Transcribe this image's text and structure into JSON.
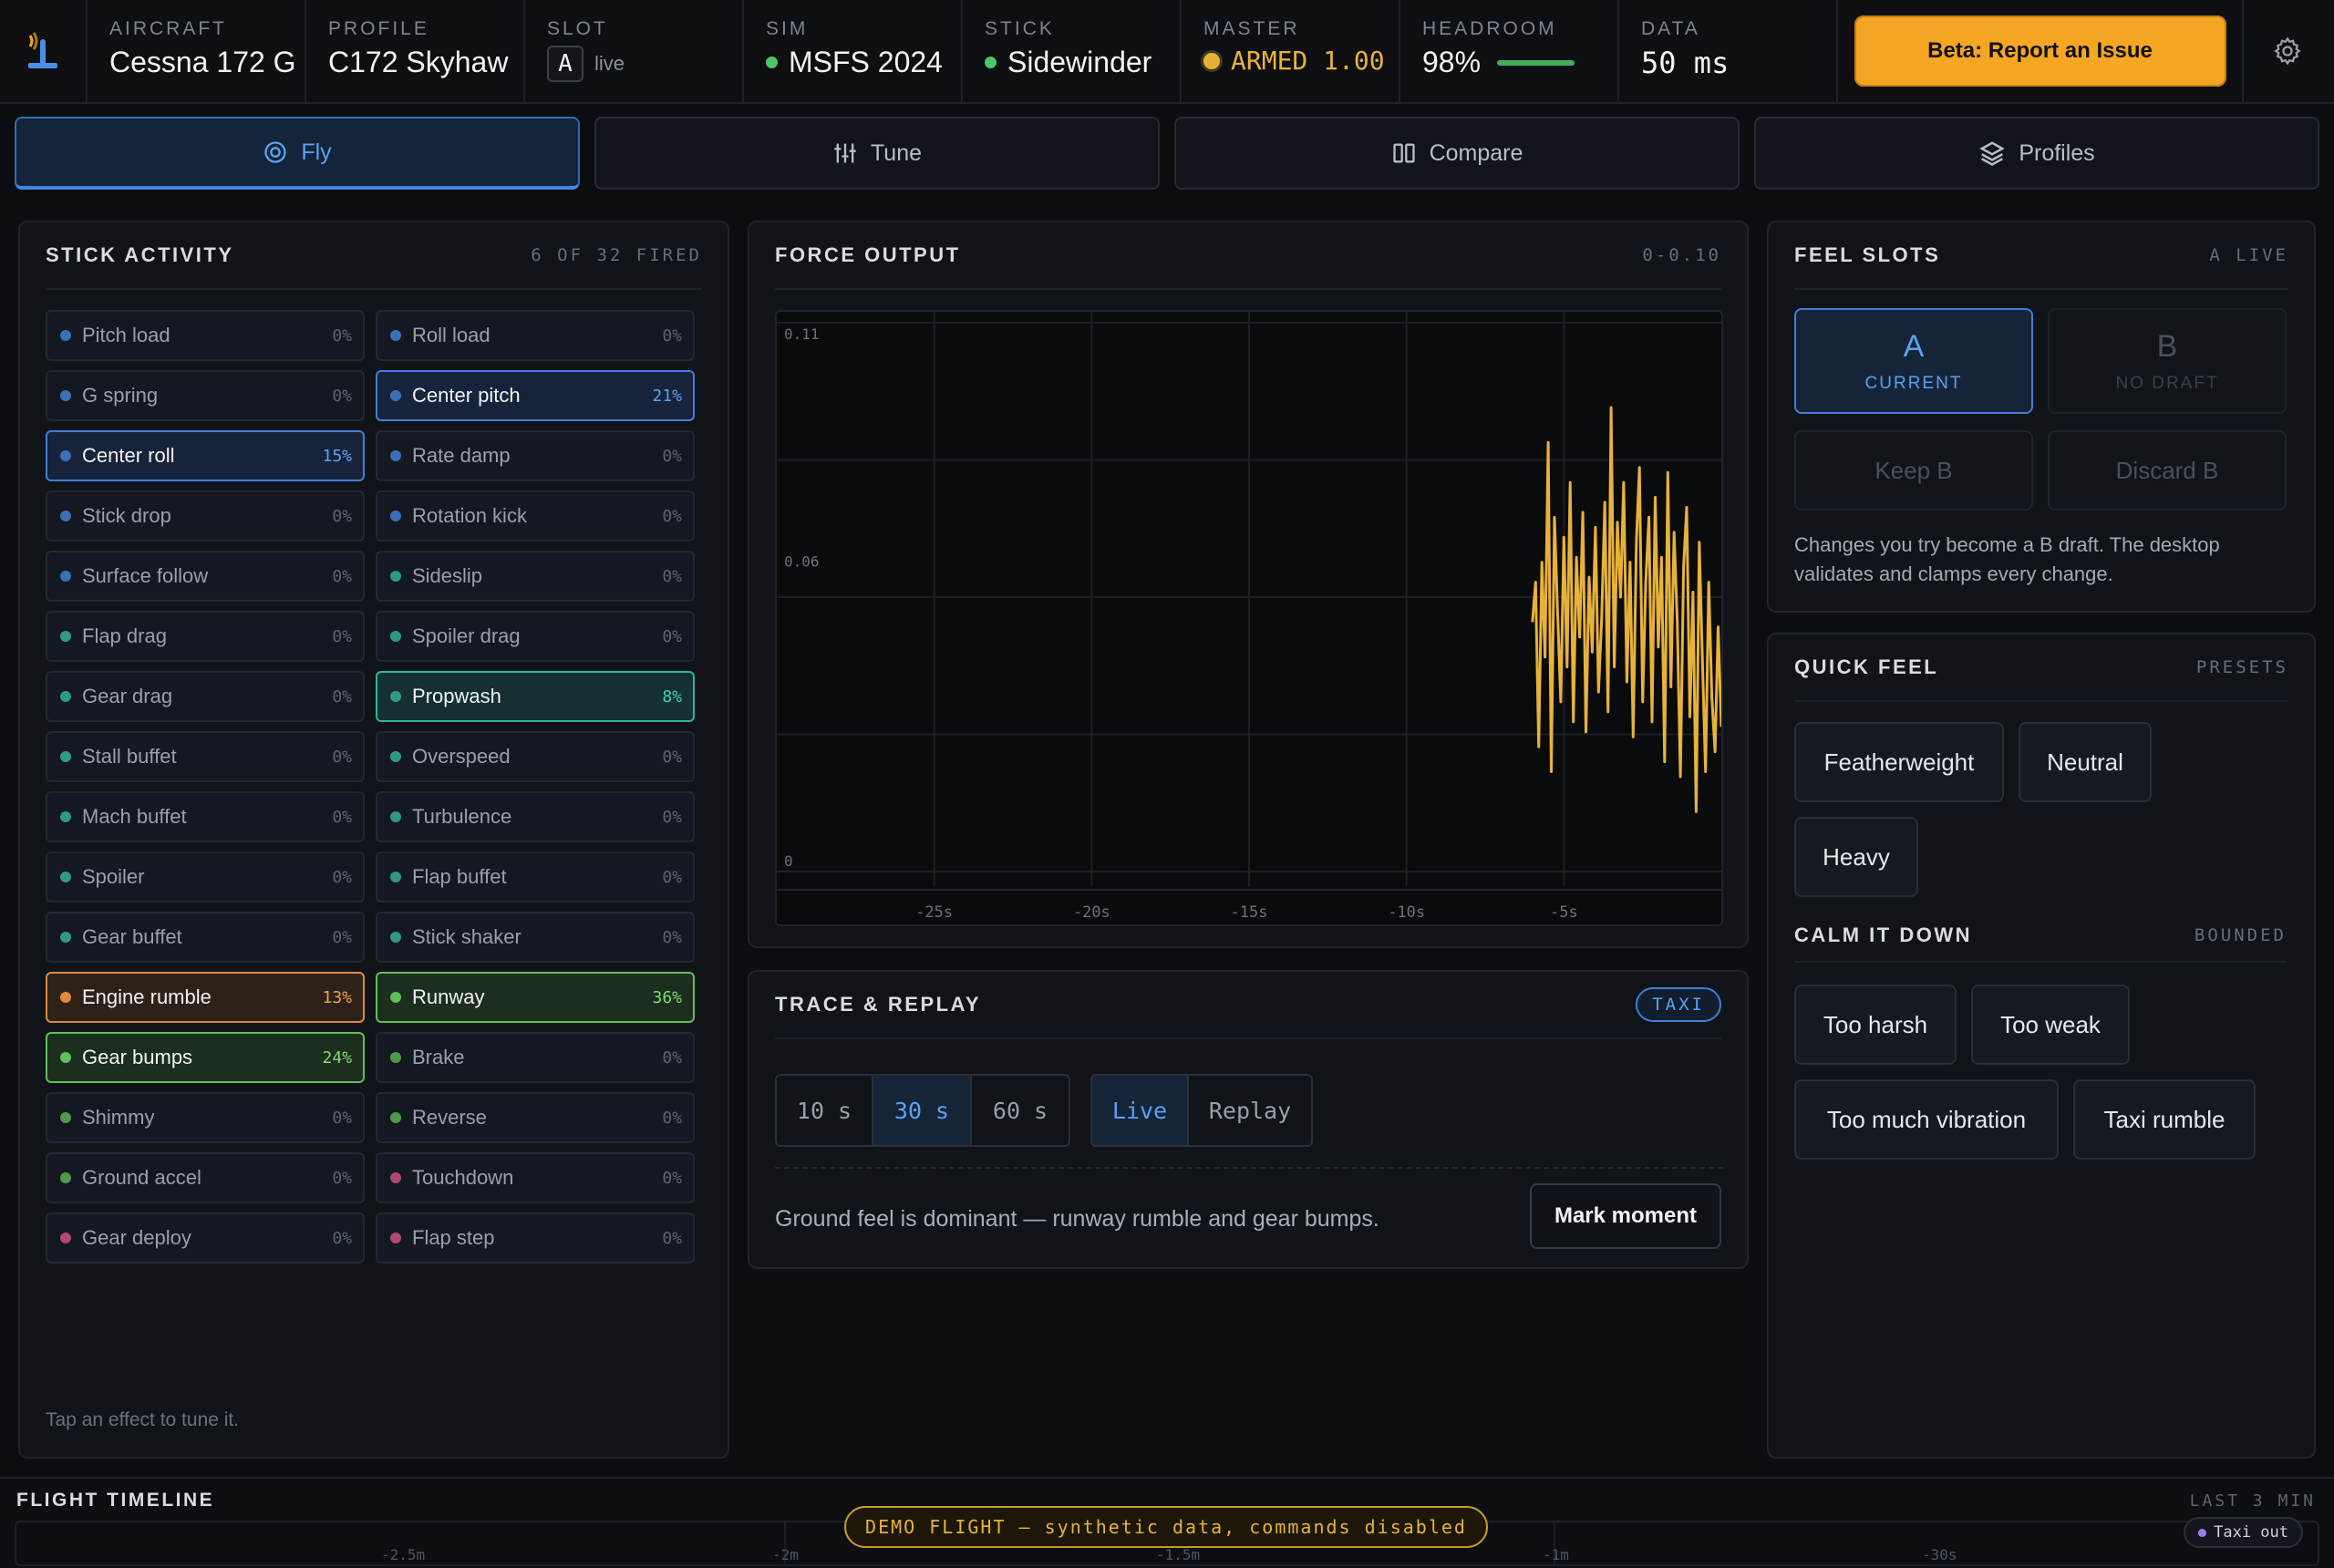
{
  "topbar": {
    "aircraft": {
      "label": "AIRCRAFT",
      "value": "Cessna 172 G"
    },
    "profile": {
      "label": "PROFILE",
      "value": "C172 Skyhaw"
    },
    "slot": {
      "label": "SLOT",
      "letter": "A",
      "state": "live"
    },
    "sim": {
      "label": "SIM",
      "value": "MSFS 2024",
      "status_color": "#4cc76a"
    },
    "stick": {
      "label": "STICK",
      "value": "Sidewinder",
      "status_color": "#4cc76a"
    },
    "master": {
      "label": "MASTER",
      "value": "ARMED 1.00",
      "color": "#e8b23a"
    },
    "headroom": {
      "label": "HEADROOM",
      "value": "98%",
      "level": 0.98
    },
    "data": {
      "label": "DATA",
      "value": "50 ms"
    },
    "beta_button": "Beta: Report an Issue",
    "settings_icon": "gear-icon"
  },
  "tabs": [
    {
      "label": "Fly",
      "icon": "target-icon",
      "active": true
    },
    {
      "label": "Tune",
      "icon": "sliders-icon",
      "active": false
    },
    {
      "label": "Compare",
      "icon": "columns-icon",
      "active": false
    },
    {
      "label": "Profiles",
      "icon": "layers-icon",
      "active": false
    }
  ],
  "stick_activity": {
    "title": "STICK ACTIVITY",
    "meta": "6 OF 32 FIRED",
    "hint": "Tap an effect to tune it.",
    "effects": [
      {
        "name": "Pitch load",
        "pct": "0%",
        "dot": "#3b6fb8"
      },
      {
        "name": "Roll load",
        "pct": "0%",
        "dot": "#3b6fb8"
      },
      {
        "name": "G spring",
        "pct": "0%",
        "dot": "#3b6fb8"
      },
      {
        "name": "Center pitch",
        "pct": "21%",
        "dot": "#3b6fb8",
        "hl": "blue"
      },
      {
        "name": "Center roll",
        "pct": "15%",
        "dot": "#3b6fb8",
        "hl": "blue"
      },
      {
        "name": "Rate damp",
        "pct": "0%",
        "dot": "#3b6fb8"
      },
      {
        "name": "Stick drop",
        "pct": "0%",
        "dot": "#3b6fb8"
      },
      {
        "name": "Rotation kick",
        "pct": "0%",
        "dot": "#3b6fb8"
      },
      {
        "name": "Surface follow",
        "pct": "0%",
        "dot": "#3b6fb8"
      },
      {
        "name": "Sideslip",
        "pct": "0%",
        "dot": "#2f9a82"
      },
      {
        "name": "Flap drag",
        "pct": "0%",
        "dot": "#2f9a82"
      },
      {
        "name": "Spoiler drag",
        "pct": "0%",
        "dot": "#2f9a82"
      },
      {
        "name": "Gear drag",
        "pct": "0%",
        "dot": "#2f9a82"
      },
      {
        "name": "Propwash",
        "pct": "8%",
        "dot": "#2f9a82",
        "hl": "teal"
      },
      {
        "name": "Stall buffet",
        "pct": "0%",
        "dot": "#2f9a82"
      },
      {
        "name": "Overspeed",
        "pct": "0%",
        "dot": "#2f9a82"
      },
      {
        "name": "Mach buffet",
        "pct": "0%",
        "dot": "#2f9a82"
      },
      {
        "name": "Turbulence",
        "pct": "0%",
        "dot": "#2f9a82"
      },
      {
        "name": "Spoiler",
        "pct": "0%",
        "dot": "#2f9a82"
      },
      {
        "name": "Flap buffet",
        "pct": "0%",
        "dot": "#2f9a82"
      },
      {
        "name": "Gear buffet",
        "pct": "0%",
        "dot": "#2f9a82"
      },
      {
        "name": "Stick shaker",
        "pct": "0%",
        "dot": "#2f9a82"
      },
      {
        "name": "Engine rumble",
        "pct": "13%",
        "dot": "#e08a3a",
        "hl": "orange"
      },
      {
        "name": "Runway",
        "pct": "36%",
        "dot": "#5fbf5a",
        "hl": "green"
      },
      {
        "name": "Gear bumps",
        "pct": "24%",
        "dot": "#5fbf5a",
        "hl": "green"
      },
      {
        "name": "Brake",
        "pct": "0%",
        "dot": "#4f9a4a"
      },
      {
        "name": "Shimmy",
        "pct": "0%",
        "dot": "#4f9a4a"
      },
      {
        "name": "Reverse",
        "pct": "0%",
        "dot": "#4f9a4a"
      },
      {
        "name": "Ground accel",
        "pct": "0%",
        "dot": "#4f9a4a"
      },
      {
        "name": "Touchdown",
        "pct": "0%",
        "dot": "#b0496e"
      },
      {
        "name": "Gear deploy",
        "pct": "0%",
        "dot": "#b0496e"
      },
      {
        "name": "Flap step",
        "pct": "0%",
        "dot": "#b0496e"
      }
    ]
  },
  "force_output": {
    "title": "FORCE OUTPUT",
    "meta": "0-0.10"
  },
  "chart_data": {
    "type": "line",
    "title": "",
    "xlabel": "",
    "ylabel": "",
    "x_ticks": [
      "-25s",
      "-20s",
      "-15s",
      "-10s",
      "-5s"
    ],
    "x_tick_values": [
      -25,
      -20,
      -15,
      -10,
      -5
    ],
    "y_ticks": [
      "0",
      "0.06",
      "0.11"
    ],
    "y_tick_values": [
      0,
      0.06,
      0.11
    ],
    "xlim": [
      -30,
      0
    ],
    "ylim": [
      0,
      0.11
    ],
    "grid": true,
    "color": "#e8b23a",
    "series": [
      {
        "x": [
          -6.0,
          -5.9,
          -5.8,
          -5.7,
          -5.6,
          -5.5,
          -5.4,
          -5.3,
          -5.2,
          -5.1,
          -5.0,
          -4.9,
          -4.8,
          -4.7,
          -4.6,
          -4.5,
          -4.4,
          -4.3,
          -4.2,
          -4.1,
          -4.0,
          -3.9,
          -3.8,
          -3.7,
          -3.6,
          -3.5,
          -3.4,
          -3.3,
          -3.2,
          -3.1,
          -3.0,
          -2.9,
          -2.8,
          -2.7,
          -2.6,
          -2.5,
          -2.4,
          -2.3,
          -2.2,
          -2.1,
          -2.0,
          -1.9,
          -1.8,
          -1.7,
          -1.6,
          -1.5,
          -1.4,
          -1.3,
          -1.2,
          -1.1,
          -1.0,
          -0.9,
          -0.8,
          -0.7,
          -0.6,
          -0.5,
          -0.4,
          -0.3,
          -0.2,
          -0.1,
          0.0
        ],
        "values": [
          0.05,
          0.058,
          0.025,
          0.062,
          0.043,
          0.086,
          0.02,
          0.071,
          0.052,
          0.034,
          0.067,
          0.041,
          0.078,
          0.03,
          0.063,
          0.047,
          0.072,
          0.028,
          0.059,
          0.044,
          0.069,
          0.036,
          0.051,
          0.074,
          0.032,
          0.093,
          0.041,
          0.07,
          0.055,
          0.078,
          0.038,
          0.062,
          0.027,
          0.066,
          0.081,
          0.034,
          0.058,
          0.071,
          0.03,
          0.075,
          0.045,
          0.063,
          0.022,
          0.08,
          0.037,
          0.068,
          0.05,
          0.019,
          0.061,
          0.073,
          0.031,
          0.056,
          0.012,
          0.066,
          0.042,
          0.02,
          0.058,
          0.035,
          0.024,
          0.049,
          0.029
        ]
      }
    ]
  },
  "trace_replay": {
    "title": "TRACE & REPLAY",
    "badge": "TAXI",
    "windows": [
      "10 s",
      "30 s",
      "60 s"
    ],
    "window_selected": "30 s",
    "modes": [
      "Live",
      "Replay"
    ],
    "mode_selected": "Live",
    "note": "Ground feel is dominant — runway rumble and gear bumps.",
    "mark_button": "Mark moment"
  },
  "feel_slots": {
    "title": "FEEL SLOTS",
    "meta": "A LIVE",
    "slot_a": {
      "letter": "A",
      "sub": "CURRENT"
    },
    "slot_b": {
      "letter": "B",
      "sub": "NO DRAFT"
    },
    "keep_b": "Keep B",
    "discard_b": "Discard B",
    "note": "Changes you try become a B draft. The desktop validates and clamps every change."
  },
  "quick_feel": {
    "title": "QUICK FEEL",
    "meta": "PRESETS",
    "presets": [
      "Featherweight",
      "Neutral",
      "Heavy"
    ],
    "calm_title": "CALM IT DOWN",
    "calm_meta": "BOUNDED",
    "calm": [
      "Too harsh",
      "Too weak",
      "Too much vibration",
      "Taxi rumble"
    ]
  },
  "timeline": {
    "title": "FLIGHT TIMELINE",
    "meta": "LAST 3 MIN",
    "ticks": [
      "-2.5m",
      "-2m",
      "-1.5m",
      "-1m",
      "-30s"
    ],
    "banner": "DEMO FLIGHT — synthetic data, commands disabled",
    "marker": "Taxi out",
    "marker_color": "#9b7cf0"
  }
}
